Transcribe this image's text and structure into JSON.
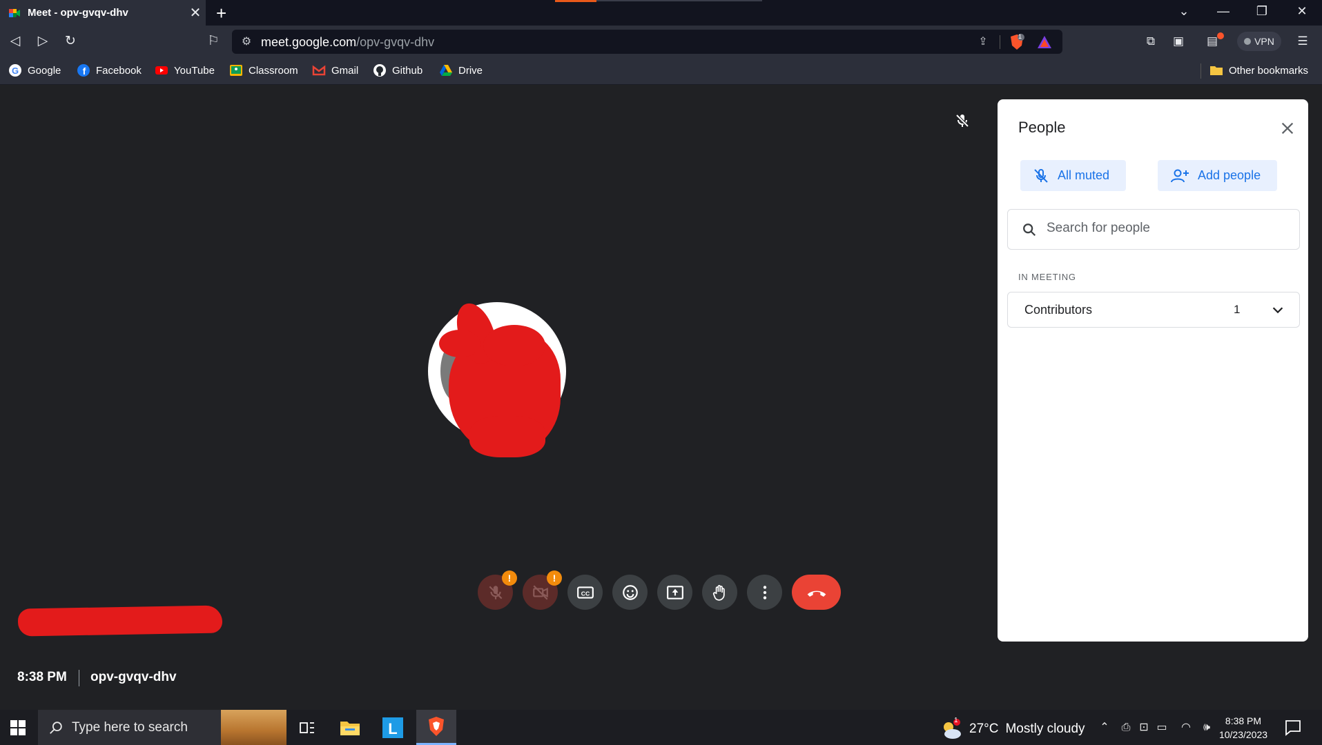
{
  "browser": {
    "tab_title": "Meet - opv-gvqv-dhv",
    "url_host": "meet.google.com",
    "url_path": "/opv-gvqv-dhv",
    "vpn_label": "VPN",
    "shields_badge": "1"
  },
  "bookmarks": {
    "items": [
      {
        "label": "Google",
        "icon": "google-icon",
        "color": "#4285f4"
      },
      {
        "label": "Facebook",
        "icon": "facebook-icon",
        "color": "#1877f2"
      },
      {
        "label": "YouTube",
        "icon": "youtube-icon",
        "color": "#ff0000"
      },
      {
        "label": "Classroom",
        "icon": "classroom-icon",
        "color": "#f5b400"
      },
      {
        "label": "Gmail",
        "icon": "gmail-icon",
        "color": "#ea4335"
      },
      {
        "label": "Github",
        "icon": "github-icon",
        "color": "#ffffff"
      },
      {
        "label": "Drive",
        "icon": "drive-icon",
        "color": "#34a853"
      }
    ],
    "other": "Other bookmarks"
  },
  "meeting": {
    "time": "8:38 PM",
    "code": "opv-gvqv-dhv",
    "people_count": "1",
    "mic_warning": "!",
    "cam_warning": "!"
  },
  "people_panel": {
    "title": "People",
    "all_muted_label": "All muted",
    "add_people_label": "Add people",
    "search_placeholder": "Search for people",
    "section_label": "IN MEETING",
    "contributors_label": "Contributors",
    "contributors_count": "1"
  },
  "taskbar": {
    "search_placeholder": "Type here to search",
    "weather_temp": "27°C",
    "weather_desc": "Mostly cloudy",
    "weather_badge": "1",
    "clock_time": "8:38 PM",
    "clock_date": "10/23/2023"
  },
  "colors": {
    "accent": "#1a73e8",
    "end_call": "#ea4335",
    "warning": "#f28b0c",
    "stage_bg": "#202124"
  }
}
